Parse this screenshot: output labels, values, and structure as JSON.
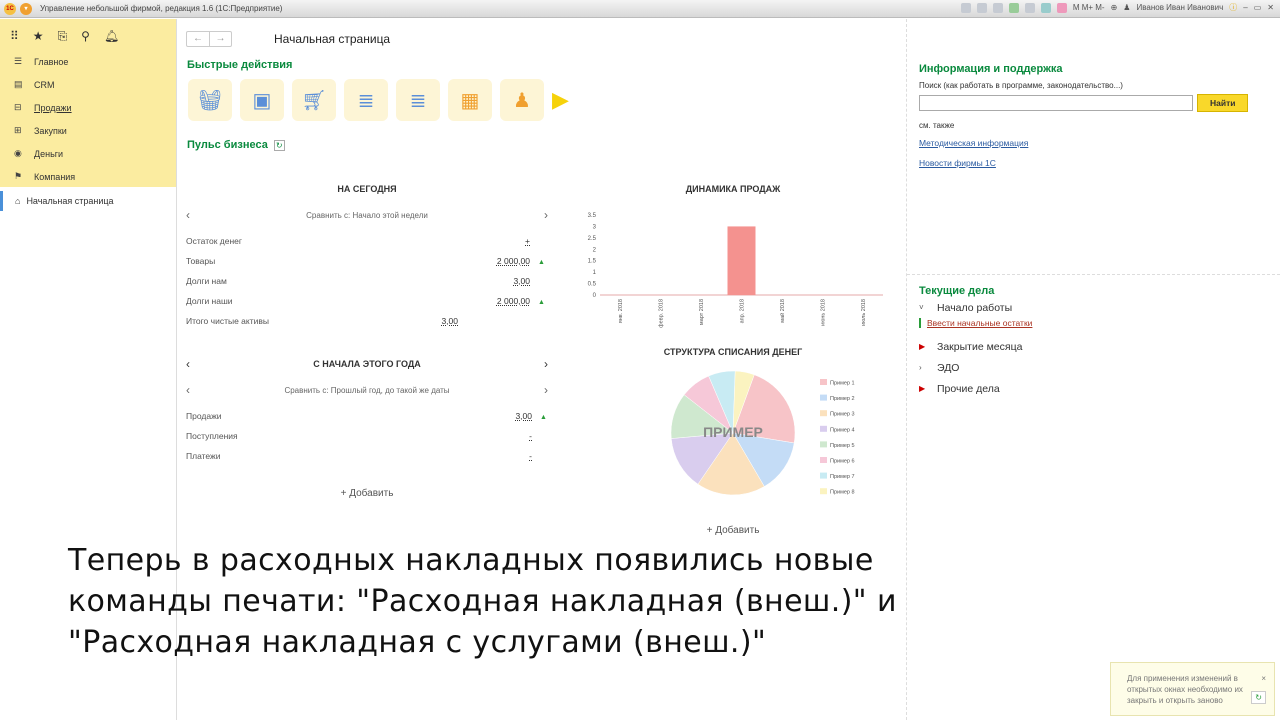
{
  "window": {
    "title": "Управление небольшой фирмой, редакция 1.6  (1С:Предприятие)",
    "user": "Иванов Иван Иванович"
  },
  "sidebar": {
    "items": [
      {
        "label": "Главное",
        "icon": "menu-icon"
      },
      {
        "label": "CRM",
        "icon": "crm-icon"
      },
      {
        "label": "Продажи",
        "icon": "basket-icon"
      },
      {
        "label": "Закупки",
        "icon": "cart-icon"
      },
      {
        "label": "Деньги",
        "icon": "money-icon"
      },
      {
        "label": "Компания",
        "icon": "flag-icon"
      }
    ],
    "open_window": "Начальная страница"
  },
  "page": {
    "title": "Начальная страница"
  },
  "quick_actions": {
    "title": "Быстрые действия"
  },
  "pulse": {
    "title": "Пульс бизнеса",
    "today": {
      "title": "НА СЕГОДНЯ",
      "compare": "Сравнить с: Начало этой недели",
      "rows": [
        {
          "label": "Остаток денег",
          "value": "+"
        },
        {
          "label": "Товары",
          "value": "2 000,00",
          "up": "▲"
        },
        {
          "label": "Долги нам",
          "value": "3,00"
        },
        {
          "label": "Долги наши",
          "value": "2 000,00",
          "up": "▲"
        },
        {
          "label": "Итого чистые активы",
          "value": "3,00"
        }
      ]
    },
    "year": {
      "title": "С НАЧАЛА ЭТОГО ГОДА",
      "compare": "Сравнить с: Прошлый год, до такой же даты",
      "rows": [
        {
          "label": "Продажи",
          "value": "3,00",
          "up": "▲"
        },
        {
          "label": "Поступления",
          "value": "-"
        },
        {
          "label": "Платежи",
          "value": "-"
        }
      ]
    },
    "add": "+ Добавить",
    "add2": "+ Добавить"
  },
  "chart_data": [
    {
      "type": "bar",
      "title": "ДИНАМИКА ПРОДАЖ",
      "categories": [
        "янв. 2018",
        "февр. 2018",
        "март 2018",
        "апр. 2018",
        "май 2018",
        "июнь 2018",
        "июль 2018"
      ],
      "values": [
        0,
        0,
        0,
        3,
        0,
        0,
        0
      ],
      "ylim": [
        0,
        3.5
      ],
      "yticks": [
        "0",
        "0.5",
        "1",
        "1.5",
        "2",
        "2.5",
        "3",
        "3.5"
      ],
      "color": "#f4928f"
    },
    {
      "type": "pie",
      "title": "СТРУКТУРА СПИСАНИЯ ДЕНЕГ",
      "watermark": "ПРИМЕР",
      "categories": [
        "Пример 1",
        "Пример 2",
        "Пример 3",
        "Пример 4",
        "Пример 5",
        "Пример 6",
        "Пример 7",
        "Пример 8"
      ],
      "values": [
        22,
        14,
        18,
        14,
        12,
        8,
        7,
        5
      ],
      "colors": [
        "#f7c4c8",
        "#c4dcf6",
        "#fbe1bd",
        "#d9cdee",
        "#cfe8cf",
        "#f6c8d8",
        "#c8ebf3",
        "#fbf3c0"
      ],
      "legend": "right"
    }
  ],
  "info": {
    "title": "Информация и поддержка",
    "search_label": "Поиск (как работать в программе, законодательство...)",
    "search_value": "",
    "find": "Найти",
    "see_also": "см. также",
    "links": [
      "Методическая информация",
      "Новости фирмы 1С"
    ]
  },
  "tasks": {
    "title": "Текущие дела",
    "start": "Начало работы",
    "start_link": "Ввести начальные остатки",
    "items": [
      "Закрытие месяца",
      "ЭДО",
      "Прочие дела"
    ]
  },
  "subtitle": [
    "Теперь в расходных накладных появились новые",
    "команды печати: \"Расходная накладная (внеш.)\" и",
    "\"Расходная накладная с услугами (внеш.)\""
  ],
  "toast": {
    "text": "Для применения изменений в открытых окнах необходимо их закрыть и открыть заново",
    "close": "×"
  }
}
